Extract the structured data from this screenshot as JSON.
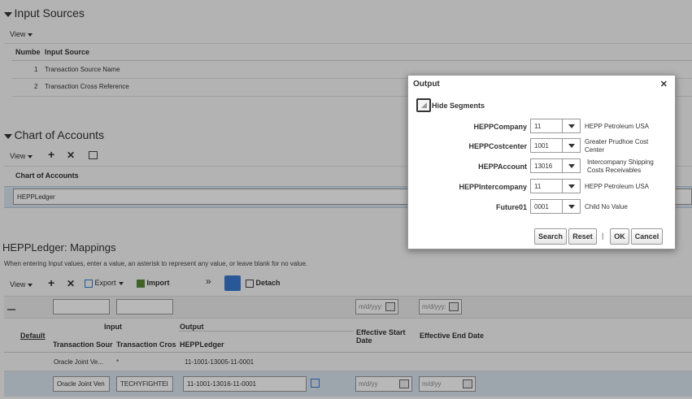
{
  "input_sources": {
    "title": "Input Sources",
    "view_label": "View",
    "columns": [
      "Numbe",
      "Input Source"
    ],
    "rows": [
      {
        "num": "1",
        "source": "Transaction Source Name"
      },
      {
        "num": "2",
        "source": "Transaction Cross Reference"
      }
    ]
  },
  "chart_of_accounts": {
    "title": "Chart of Accounts",
    "view_label": "View",
    "column": "Chart of Accounts",
    "row": "HEPPLedger"
  },
  "mappings": {
    "title": "HEPPLedger: Mappings",
    "hint": "When entering Input values, enter a value, an asterisk to represent any value, or leave blank for no value.",
    "toolbar": {
      "view": "View",
      "export": "Export",
      "import": "Import",
      "more": "»",
      "detach": "Detach"
    },
    "filter_date_placeholder": "m/d/yyy:",
    "headers": {
      "default": "Default",
      "input": "Input",
      "output": "Output",
      "transaction_source": "Transaction Sour",
      "transaction_cross": "Transaction Cros",
      "hepp_ledger": "HEPPLedger",
      "eff_start": "Effective Start Date",
      "eff_end": "Effective End Date"
    },
    "rows": [
      {
        "source": "Oracle Joint Ve...",
        "cross": "*",
        "ledger": "11-1001-13005-11-0001"
      },
      {
        "source": "Oracle Joint Ven",
        "cross": "TECHYFIGHTEI",
        "ledger": "11-1001-13016-11-0001",
        "start": "m/d/yy",
        "end": "m/d/yy"
      }
    ]
  },
  "dialog": {
    "title": "Output",
    "close": "✕",
    "hide_segments": "Hide Segments",
    "segments": [
      {
        "label": "HEPPCompany",
        "value": "11",
        "desc": "HEPP Petroleum USA"
      },
      {
        "label": "HEPPCostcenter",
        "value": "1001",
        "desc": "Greater Prudhoe Cost Center"
      },
      {
        "label": "HEPPAccount",
        "value": "13016",
        "desc": "Intercompany Shipping Costs Receivables"
      },
      {
        "label": "HEPPIntercompany",
        "value": "11",
        "desc": "HEPP Petroleum USA"
      },
      {
        "label": "Future01",
        "value": "0001",
        "desc": "Child No Value"
      }
    ],
    "buttons": {
      "search": "Search",
      "reset": "Reset",
      "sep": "|",
      "ok": "OK",
      "cancel": "Cancel"
    }
  },
  "colors": {
    "accent": "#3a7bd5",
    "selected_row": "#dce6f0"
  }
}
